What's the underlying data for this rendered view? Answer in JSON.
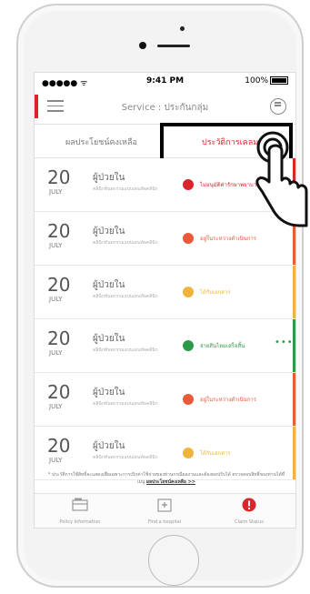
{
  "status_bar": {
    "carrier": "●●●●● ᯤ",
    "time": "9:41 PM",
    "battery": "100%"
  },
  "nav": {
    "title": "Service : ประกันกลุ่ม"
  },
  "tabs": {
    "benefits": "ผลประโยชน์คงเหลือ",
    "claim_history": "ประวัติการเคลม"
  },
  "claims": [
    {
      "day": "20",
      "month": "JULY",
      "patient_type": "ผู้ป่วยใน",
      "hospital": "คลินิกทันตกรรมแบบเดนทัลคลินิก",
      "status": "ไม่อนุมัติค่ารักษาพยาบาล",
      "status_color": "#d8262b",
      "more": "•••",
      "stripe": "#d8262b"
    },
    {
      "day": "20",
      "month": "JULY",
      "patient_type": "ผู้ป่วยใน",
      "hospital": "คลินิกทันตกรรมแบบเดนทัลคลินิก",
      "status": "อยู่ในระหว่างดำเนินการ",
      "status_color": "#e9593a",
      "more": "",
      "stripe": "#e9593a"
    },
    {
      "day": "20",
      "month": "JULY",
      "patient_type": "ผู้ป่วยใน",
      "hospital": "คลินิกทันตกรรมแบบเดนทัลคลินิก",
      "status": "ได้รับเอกสาร",
      "status_color": "#f0b43c",
      "more": "",
      "stripe": "#f0b43c"
    },
    {
      "day": "20",
      "month": "JULY",
      "patient_type": "ผู้ป่วยใน",
      "hospital": "คลินิกทันตกรรมแบบเดนทัลคลินิก",
      "status": "จ่ายสินไหมเสร็จสิ้น",
      "status_color": "#2a9a47",
      "more": "•••",
      "stripe": "#2a9a47"
    },
    {
      "day": "20",
      "month": "JULY",
      "patient_type": "ผู้ป่วยใน",
      "hospital": "คลินิกทันตกรรมแบบเดนทัลคลินิก",
      "status": "อยู่ในระหว่างดำเนินการ",
      "status_color": "#e9593a",
      "more": "",
      "stripe": "#e9593a"
    },
    {
      "day": "20",
      "month": "JULY",
      "patient_type": "ผู้ป่วยใน",
      "hospital": "คลินิกทันตกรรมแบบเดนทัลคลินิก",
      "status": "ได้รับเอกสาร",
      "status_color": "#f0b43c",
      "more": "",
      "stripe": "#f0b43c"
    }
  ],
  "footnote": {
    "text": "* ประวัติการใช้สิทธิ์จะแสดงเพื่อเฉพาะการเบิกค่าใช้จ่ายของท่านกรณีผลงานและต้องผลปรับได้ ตรวจสอบสิทธิ์ของท่านได้ที่ เมนู",
    "link": "ผลประโยชน์คงเหลือ >>"
  },
  "tabbar": [
    {
      "label": "Policy Information",
      "icon": "policy-card-icon"
    },
    {
      "label": "Find a hospital",
      "icon": "hospital-icon"
    },
    {
      "label": "Claim Status",
      "icon": "alert-icon"
    }
  ]
}
